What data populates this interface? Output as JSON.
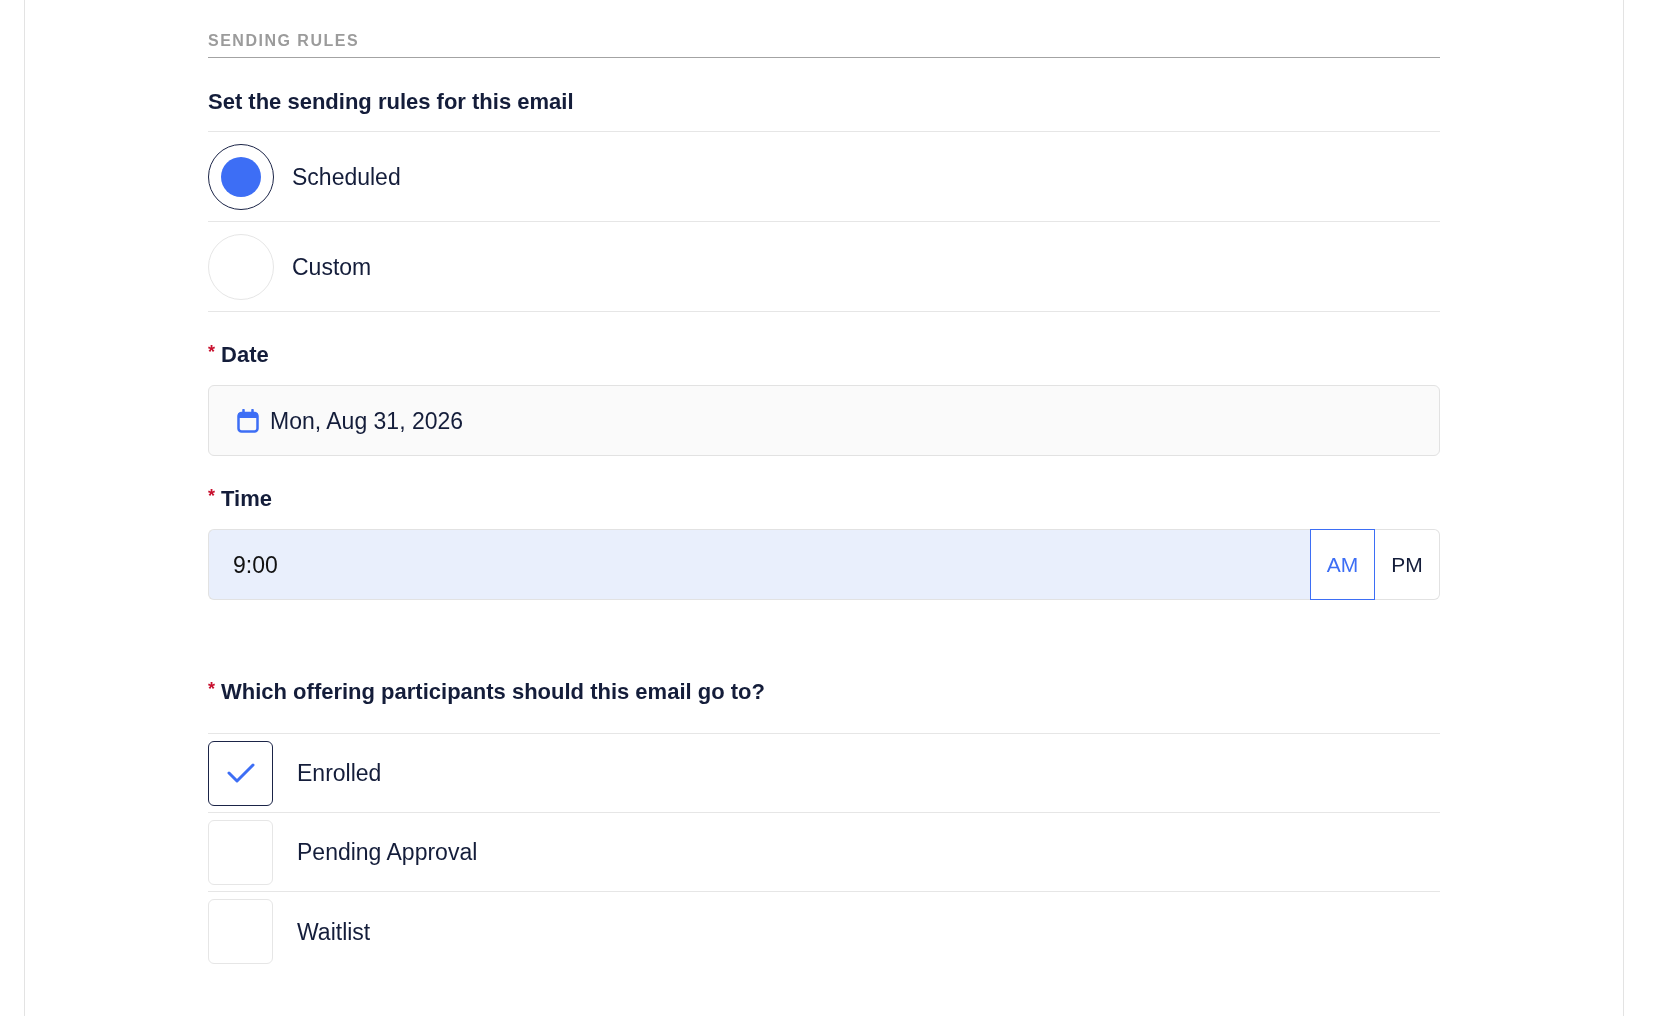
{
  "section": {
    "title": "SENDING RULES"
  },
  "sending_rules": {
    "heading": "Set the sending rules for this email",
    "options": [
      {
        "label": "Scheduled",
        "selected": true
      },
      {
        "label": "Custom",
        "selected": false
      }
    ]
  },
  "date": {
    "required_mark": "*",
    "label": "Date",
    "value": "Mon, Aug 31, 2026"
  },
  "time": {
    "required_mark": "*",
    "label": "Time",
    "value": "9:00",
    "periods": [
      {
        "label": "AM",
        "selected": true
      },
      {
        "label": "PM",
        "selected": false
      }
    ]
  },
  "participants": {
    "required_mark": "*",
    "question": "Which offering participants should this email go to?",
    "options": [
      {
        "label": "Enrolled",
        "checked": true
      },
      {
        "label": "Pending Approval",
        "checked": false
      },
      {
        "label": "Waitlist",
        "checked": false
      }
    ]
  }
}
